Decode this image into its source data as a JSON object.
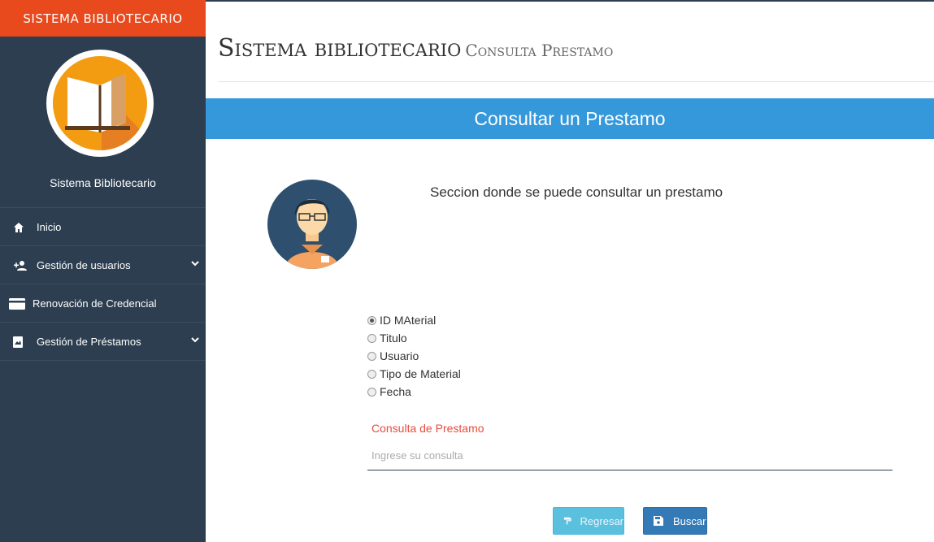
{
  "sidebar": {
    "brand": "SISTEMA BIBLIOTECARIO",
    "profile_name": "Sistema Bibliotecario",
    "items": [
      {
        "label": "Inicio",
        "icon": "home-icon"
      },
      {
        "label": "Gestión de usuarios",
        "icon": "add-user-icon"
      },
      {
        "label": "Renovación de Credencial",
        "icon": "credit-card-icon"
      },
      {
        "label": "Gestión de Préstamos",
        "icon": "book-image-icon"
      }
    ]
  },
  "header": {
    "title": "Sistema bibliotecario",
    "subtitle": "Consulta Prestamo"
  },
  "panel": {
    "title": "Consultar un Prestamo",
    "description": "Seccion donde se puede consultar un prestamo"
  },
  "form": {
    "options": [
      "ID MAterial",
      "Titulo",
      "Usuario",
      "Tipo de Material",
      "Fecha"
    ],
    "selected": "ID MAterial",
    "field_label": "Consulta de Prestamo",
    "field_placeholder": "Ingrese su consulta",
    "field_value": ""
  },
  "buttons": {
    "back": "Regresar",
    "search": "Buscar"
  },
  "colors": {
    "sidebar_bg": "#2c3e50",
    "brand_bg": "#e8491d",
    "panel_header": "#3498db",
    "label_red": "#e74c3c",
    "btn_info": "#5bc0de",
    "btn_primary": "#337ab7"
  }
}
